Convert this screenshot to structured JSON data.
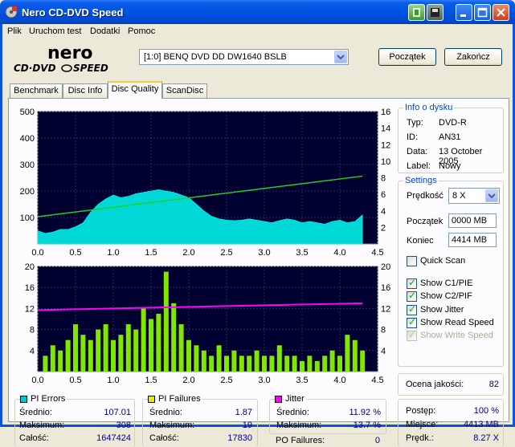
{
  "window": {
    "title": "Nero CD-DVD Speed"
  },
  "menu": [
    "Plik",
    "Uruchom test",
    "Dodatki",
    "Pomoc"
  ],
  "drive": {
    "selected": "[1:0]  BENQ DVD DD DW1640 BSLB"
  },
  "buttons": {
    "start": "Początek",
    "exit": "Zakończ"
  },
  "tabs": [
    "Benchmark",
    "Disc Info",
    "Disc Quality",
    "ScanDisc"
  ],
  "active_tab": "Disc Quality",
  "disc_info": {
    "title": "Info o dysku",
    "fields": [
      {
        "label": "Typ:",
        "value": "DVD-R"
      },
      {
        "label": "ID:",
        "value": "AN31"
      },
      {
        "label": "Data:",
        "value": "13 October 2005"
      },
      {
        "label": "Label:",
        "value": "Nowy"
      }
    ]
  },
  "settings": {
    "title": "Settings",
    "speed_label": "Prędkość",
    "speed_value": "8 X",
    "start_label": "Początek",
    "start_value": "0000 MB",
    "end_label": "Koniec",
    "end_value": "4414 MB",
    "quick_scan": "Quick Scan",
    "checks": [
      {
        "label": "Show C1/PIE",
        "checked": true,
        "disabled": false
      },
      {
        "label": "Show C2/PIF",
        "checked": true,
        "disabled": false
      },
      {
        "label": "Show Jitter",
        "checked": true,
        "disabled": false
      },
      {
        "label": "Show Read Speed",
        "checked": true,
        "disabled": false
      },
      {
        "label": "Show Write Speed",
        "checked": true,
        "disabled": true
      }
    ]
  },
  "quality": {
    "label": "Ocena jakości:",
    "value": "82"
  },
  "progress": {
    "rows": [
      {
        "label": "Postęp:",
        "value": "100 %"
      },
      {
        "label": "Miejsce:",
        "value": "4413 MB"
      },
      {
        "label": "Prędk.:",
        "value": "8.27 X"
      }
    ]
  },
  "pi_errors": {
    "title": "PI Errors",
    "color": "#00c8c8",
    "rows": [
      {
        "label": "Średnio:",
        "value": "107.01"
      },
      {
        "label": "Maksimum:",
        "value": "308"
      },
      {
        "label": "Całość:",
        "value": "1647424"
      }
    ]
  },
  "pi_failures": {
    "title": "PI Failures",
    "color": "#e8e800",
    "rows": [
      {
        "label": "Średnio:",
        "value": "1.87"
      },
      {
        "label": "Maksimum:",
        "value": "19"
      },
      {
        "label": "Całość:",
        "value": "17830"
      }
    ]
  },
  "jitter": {
    "title": "Jitter",
    "color": "#ff00ff",
    "rows": [
      {
        "label": "Średnio:",
        "value": "11.92 %"
      },
      {
        "label": "Maksimum:",
        "value": "13.7 %"
      }
    ]
  },
  "po_failures": {
    "label": "PO Failures:",
    "value": "0"
  },
  "chart_data": [
    {
      "type": "area",
      "name": "PI Errors / Read Speed",
      "x_ticks": [
        "0.0",
        "0.5",
        "1.0",
        "1.5",
        "2.0",
        "2.5",
        "3.0",
        "3.5",
        "4.0",
        "4.5"
      ],
      "y_left_ticks": [
        "500",
        "400",
        "300",
        "200",
        "100"
      ],
      "y_right_ticks": [
        "16",
        "14",
        "12",
        "10",
        "8",
        "6",
        "4",
        "2"
      ],
      "xlim": [
        0,
        4.5
      ],
      "ylim_left": [
        0,
        500
      ],
      "ylim_right": [
        0,
        16
      ],
      "pie_x": [
        0.0,
        0.1,
        0.2,
        0.3,
        0.4,
        0.5,
        0.6,
        0.7,
        0.8,
        0.9,
        1.0,
        1.1,
        1.2,
        1.3,
        1.4,
        1.5,
        1.6,
        1.7,
        1.8,
        1.9,
        2.0,
        2.1,
        2.2,
        2.3,
        2.4,
        2.5,
        2.6,
        2.7,
        2.8,
        2.9,
        3.0,
        3.1,
        3.2,
        3.3,
        3.4,
        3.5,
        3.6,
        3.7,
        3.8,
        3.9,
        4.0,
        4.1,
        4.2,
        4.3
      ],
      "pie_y": [
        50,
        40,
        45,
        55,
        55,
        65,
        80,
        120,
        150,
        170,
        185,
        175,
        180,
        190,
        195,
        200,
        205,
        200,
        195,
        185,
        175,
        150,
        125,
        105,
        95,
        90,
        88,
        90,
        95,
        90,
        85,
        80,
        88,
        95,
        90,
        80,
        85,
        80,
        75,
        85,
        90,
        80,
        85,
        110
      ],
      "speed_x": [
        0.0,
        4.3
      ],
      "speed_y": [
        3.3,
        8.2
      ]
    },
    {
      "type": "bar",
      "name": "PI Failures / Jitter",
      "x_ticks": [
        "0.0",
        "0.5",
        "1.0",
        "1.5",
        "2.0",
        "2.5",
        "3.0",
        "3.5",
        "4.0",
        "4.5"
      ],
      "y_left_ticks": [
        "20",
        "16",
        "12",
        "8",
        "4"
      ],
      "y_right_ticks": [
        "20",
        "16",
        "12",
        "8",
        "4"
      ],
      "xlim": [
        0,
        4.5
      ],
      "ylim": [
        0,
        20
      ],
      "pif_x": [
        0.1,
        0.2,
        0.3,
        0.4,
        0.5,
        0.6,
        0.7,
        0.8,
        0.9,
        1.0,
        1.1,
        1.2,
        1.3,
        1.4,
        1.5,
        1.6,
        1.7,
        1.8,
        1.9,
        2.0,
        2.1,
        2.2,
        2.3,
        2.4,
        2.5,
        2.6,
        2.7,
        2.8,
        2.9,
        3.0,
        3.1,
        3.2,
        3.3,
        3.4,
        3.5,
        3.6,
        3.7,
        3.8,
        3.9,
        4.0,
        4.1,
        4.2,
        4.3
      ],
      "pif_y": [
        3,
        5,
        4,
        6,
        9,
        7,
        6,
        8,
        9,
        6,
        7,
        9,
        8,
        12,
        10,
        11,
        19,
        13,
        9,
        6,
        5,
        4,
        3,
        5,
        3,
        4,
        3,
        3,
        4,
        3,
        3,
        5,
        3,
        3,
        2,
        3,
        2,
        3,
        4,
        3,
        7,
        6,
        4
      ],
      "jitter_y_start": 11.7,
      "jitter_y_end": 13.0
    }
  ]
}
